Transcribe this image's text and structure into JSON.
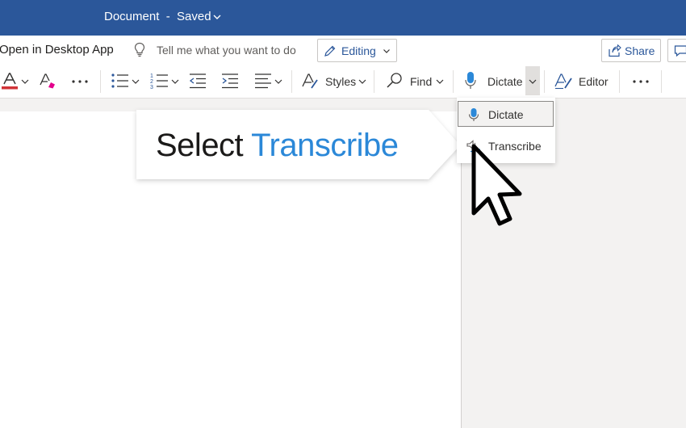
{
  "titlebar": {
    "title": "Document  -  Saved",
    "colors": {
      "background": "#2b579a"
    },
    "dropdown_icon": "chevron-down-icon"
  },
  "commandbar": {
    "open_desktop": "Open in Desktop App",
    "tell_me": "Tell me what you want to do",
    "tell_me_icon": "lightbulb-icon",
    "editing": {
      "label": "Editing",
      "icon": "pencil-icon"
    },
    "share": {
      "label": "Share",
      "icon": "share-icon"
    },
    "comments_icon": "comment-icon"
  },
  "ribbon": {
    "font_color": {
      "icon": "font-color-icon",
      "value": "#d13438"
    },
    "clear_format_icon": "clear-formatting-icon",
    "more_icon": "ellipsis-icon",
    "bullets_icon": "bulleted-list-icon",
    "numbering_icon": "numbered-list-icon",
    "decrease_indent_icon": "decrease-indent-icon",
    "increase_indent_icon": "increase-indent-icon",
    "align_icon": "align-left-icon",
    "styles": {
      "label": "Styles",
      "icon": "styles-icon"
    },
    "find": {
      "label": "Find",
      "icon": "search-icon"
    },
    "dictate": {
      "label": "Dictate",
      "icon": "microphone-icon"
    },
    "editor": {
      "label": "Editor",
      "icon": "editor-pen-icon"
    }
  },
  "dictate_menu": {
    "items": [
      {
        "label": "Dictate",
        "icon": "microphone-icon",
        "selected": true
      },
      {
        "label": "Transcribe",
        "icon": "transcribe-icon",
        "selected": false
      }
    ]
  },
  "callout": {
    "word1": "Select",
    "word2": "Transcribe",
    "colors": {
      "word1": "#1b1a19",
      "word2": "#2b88d8"
    }
  },
  "colors": {
    "accent": "#2b579a",
    "icon_blue": "#2b579a",
    "font_color_bar": "#d13438"
  }
}
